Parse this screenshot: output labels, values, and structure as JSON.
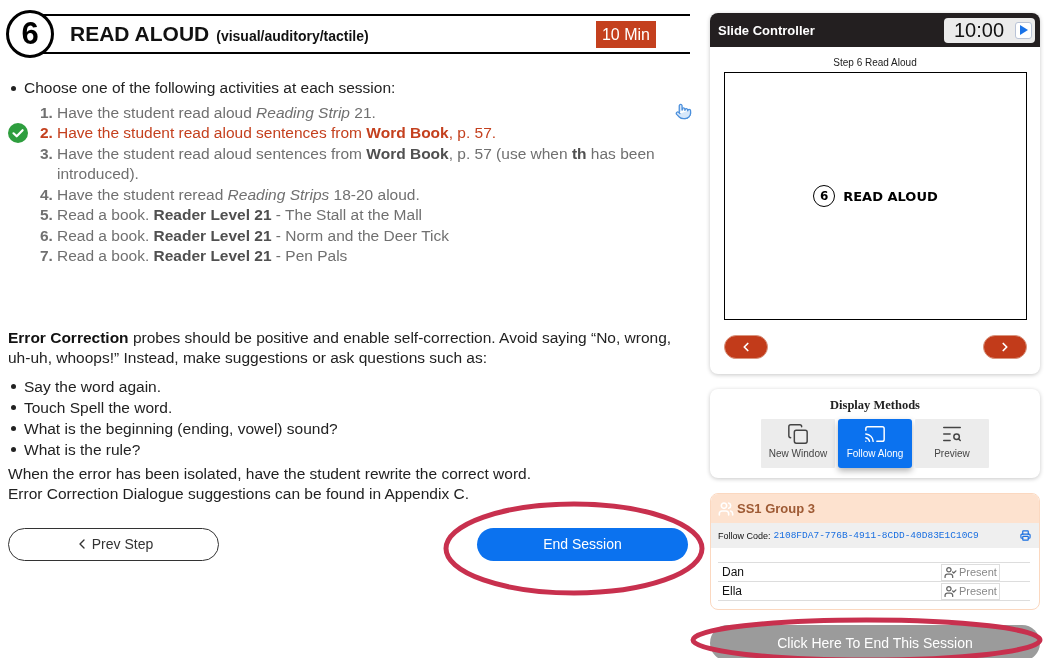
{
  "step": {
    "number": "6",
    "title": "READ ALOUD",
    "modes": "(visual/auditory/tactile)",
    "duration": "10 Min"
  },
  "activities": {
    "intro": "Choose one of the following activities at each session:",
    "items": [
      {
        "number": "1.",
        "text": "Have the student read aloud *Reading Strip* 21.",
        "checked": false
      },
      {
        "number": "2.",
        "text": "Have the student read aloud sentences from **Word Book**, p. 57.",
        "checked": true
      },
      {
        "number": "3.",
        "text": "Have the student read aloud sentences from **Word Book**, p. 57 (use when **th** has been introduced).",
        "checked": false
      },
      {
        "number": "4.",
        "text": "Have the student reread *Reading Strips* 18-20 aloud.",
        "checked": false
      },
      {
        "number": "5.",
        "text": "Read a book. **Reader Level 21** - The Stall at the Mall",
        "checked": false
      },
      {
        "number": "6.",
        "text": "Read a book. **Reader Level 21** - Norm and the Deer Tick",
        "checked": false
      },
      {
        "number": "7.",
        "text": "Read a book. **Reader Level 21** - Pen Pals",
        "checked": false
      }
    ]
  },
  "error_correction": {
    "paragraph": "**Error Correction** probes should be positive and enable self-correction. Avoid saying “No, wrong, uh-uh, whoops!” Instead, make suggestions or ask questions such as:",
    "prompts": [
      "Say the word again.",
      "Touch Spell the word.",
      "What is the beginning (ending, vowel) sound?",
      "What is the rule?"
    ],
    "notes": [
      "When the error has been isolated, have the student rewrite the correct word.",
      "Error Correction Dialogue suggestions can be found in Appendix C."
    ]
  },
  "navigation": {
    "prev": {
      "label": "Prev Step"
    },
    "end": {
      "label": "End Session",
      "circled": true
    }
  },
  "slide_controller": {
    "title": "Slide Controller",
    "timer": "10:00",
    "caption": "Step 6 Read Aloud",
    "slide": {
      "number": "6",
      "title": "READ ALOUD"
    }
  },
  "display_methods": {
    "title": "Display Methods",
    "options": [
      {
        "label": "New Window",
        "kind": "window",
        "selected": false
      },
      {
        "label": "Follow Along",
        "kind": "cast",
        "selected": true
      },
      {
        "label": "Preview",
        "kind": "preview",
        "selected": false
      }
    ]
  },
  "group": {
    "name": "SS1 Group 3",
    "follow_code_label": "Follow Code:",
    "follow_code": "2108FDA7-776B-4911-8CDD-40D83E1C10C9",
    "students": [
      {
        "name": "Dan",
        "status": "Present"
      },
      {
        "name": "Ella",
        "status": "Present"
      }
    ]
  },
  "end_session_button": {
    "label": "Click Here To End This Session",
    "circled": true
  }
}
